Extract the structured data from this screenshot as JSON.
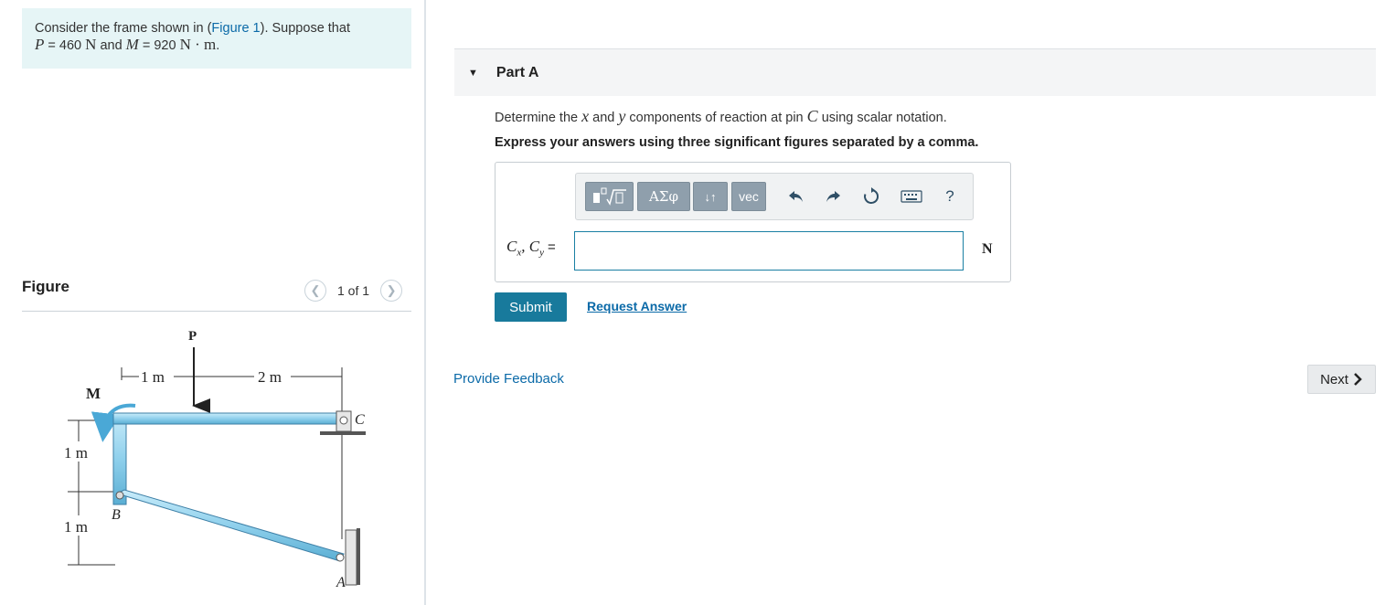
{
  "problem": {
    "text_prefix": "Consider the frame shown in (",
    "figure_link": "Figure 1",
    "text_suffix": "). Suppose that",
    "p_var": "P",
    "p_eq": " = 460 ",
    "p_unit": "N",
    "and_text": " and ",
    "m_var": "M",
    "m_eq": " = 920 ",
    "m_unit": "N · m",
    "end": "."
  },
  "figure": {
    "heading": "Figure",
    "counter": "1 of 1",
    "labels": {
      "P": "P",
      "M": "M",
      "C": "C",
      "B": "B",
      "A": "A",
      "dim_1m_top": "1 m",
      "dim_2m_top": "2 m",
      "dim_1m_upper": "1 m",
      "dim_1m_lower": "1 m"
    }
  },
  "part": {
    "title": "Part A",
    "question_prefix": "Determine the ",
    "q_x": "x",
    "q_and": " and ",
    "q_y": "y",
    "question_mid": " components of reaction at pin ",
    "q_C": "C",
    "question_suffix": " using scalar notation.",
    "instructions": "Express your answers using three significant figures separated by a comma."
  },
  "toolbar": {
    "greek_label": "ΑΣφ",
    "subsup_label": "↓↑",
    "vec_label": "vec",
    "help_label": "?",
    "icons": [
      "templates-icon",
      "undo-icon",
      "redo-icon",
      "reset-icon",
      "keyboard-icon"
    ]
  },
  "answer": {
    "label_C1": "C",
    "label_sub1": "x",
    "label_sep": ", ",
    "label_C2": "C",
    "label_sub2": "y",
    "label_eq": "=",
    "value": "",
    "unit": "N"
  },
  "actions": {
    "submit": "Submit",
    "request_answer": "Request Answer",
    "provide_feedback": "Provide Feedback",
    "next": "Next"
  },
  "colors": {
    "accent": "#187a9c",
    "link": "#0b6aa8",
    "problem_bg": "#e6f5f6",
    "frame_member": "#8fd0ec"
  }
}
